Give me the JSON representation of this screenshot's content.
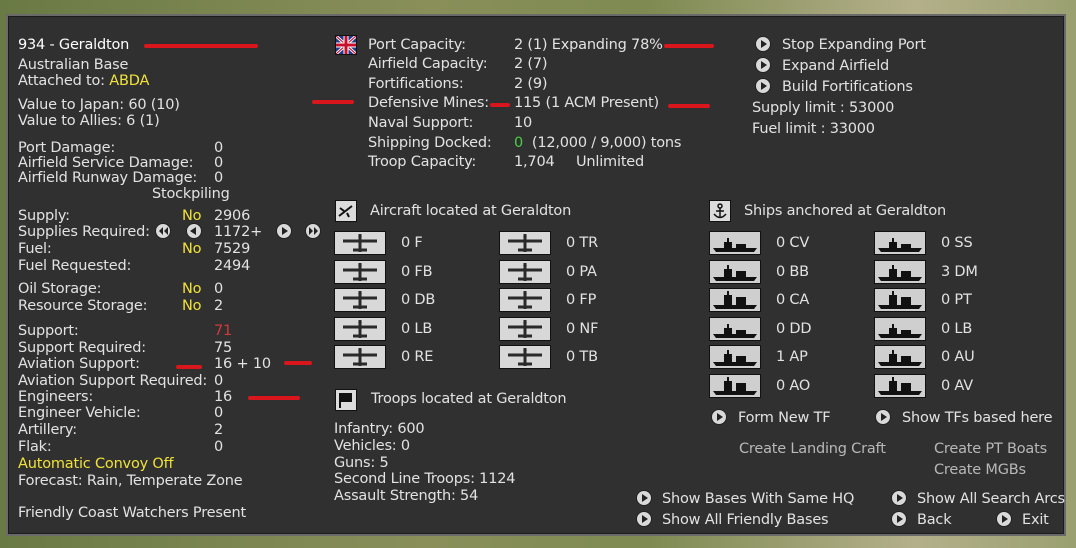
{
  "base": {
    "title": "934 - Geraldton",
    "nationality": "Australian Base",
    "attached_label": "Attached to:",
    "attached_value": "ABDA",
    "value_japan": "Value to Japan:  60 (10)",
    "value_allies": "Value to Allies:  6 (1)",
    "port_damage_label": "Port Damage:",
    "port_damage_value": "0",
    "airfield_service_label": "Airfield Service Damage:",
    "airfield_service_value": "0",
    "airfield_runway_label": "Airfield Runway Damage:",
    "airfield_runway_value": "0",
    "stockpiling_label": "Stockpiling",
    "supply_label": "Supply:",
    "supply_stock": "No",
    "supply_value": "2906",
    "supplies_required_label": "Supplies Required:",
    "supplies_required_value": "1172+",
    "fuel_label": "Fuel:",
    "fuel_stock": "No",
    "fuel_value": "7529",
    "fuel_requested_label": "Fuel Requested:",
    "fuel_requested_value": "2494",
    "oil_storage_label": "Oil Storage:",
    "oil_storage_stock": "No",
    "oil_storage_value": "0",
    "resource_storage_label": "Resource Storage:",
    "resource_storage_stock": "No",
    "resource_storage_value": "2",
    "support_label": "Support:",
    "support_value": "71",
    "support_required_label": "Support Required:",
    "support_required_value": "75",
    "aviation_support_label": "Aviation Support:",
    "aviation_support_value": "16 + 10",
    "aviation_support_required_label": "Aviation Support Required:",
    "aviation_support_required_value": "0",
    "engineers_label": "Engineers:",
    "engineers_value": "16",
    "engineer_vehicle_label": "Engineer Vehicle:",
    "engineer_vehicle_value": "0",
    "artillery_label": "Artillery:",
    "artillery_value": "2",
    "flak_label": "Flak:",
    "flak_value": "0",
    "convoy": "Automatic Convoy Off",
    "forecast": "Forecast: Rain, Temperate Zone",
    "coast_watchers": "Friendly Coast Watchers Present"
  },
  "port": {
    "port_capacity_label": "Port Capacity:",
    "port_capacity_value": "2 (1) Expanding 78%",
    "airfield_capacity_label": "Airfield Capacity:",
    "airfield_capacity_value": "2 (7)",
    "fortifications_label": "Fortifications:",
    "fortifications_value": "2 (9)",
    "defensive_mines_label": "Defensive Mines:",
    "defensive_mines_value": "115 (1 ACM Present)",
    "naval_support_label": "Naval Support:",
    "naval_support_value": "10",
    "shipping_docked_label": "Shipping Docked:",
    "shipping_docked_zero": "0",
    "shipping_docked_value": "(12,000 / 9,000) tons",
    "troop_capacity_label": "Troop Capacity:",
    "troop_capacity_value": "1,704",
    "troop_capacity_extra": "Unlimited"
  },
  "actions": {
    "stop_expanding_port": "Stop Expanding Port",
    "expand_airfield": "Expand Airfield",
    "build_fortifications": "Build Fortifications",
    "supply_limit": "Supply limit : 53000",
    "fuel_limit": "Fuel limit : 33000"
  },
  "aircraft": {
    "header": "Aircraft located at Geraldton",
    "left": [
      "0 F",
      "0 FB",
      "0 DB",
      "0 LB",
      "0 RE"
    ],
    "right": [
      "0 TR",
      "0 PA",
      "0 FP",
      "0 NF",
      "0 TB"
    ]
  },
  "ships": {
    "header": "Ships anchored at Geraldton",
    "left": [
      "0 CV",
      "0 BB",
      "0 CA",
      "0 DD",
      "1 AP",
      "0 AO"
    ],
    "right": [
      "0 SS",
      "3 DM",
      "0 PT",
      "0 LB",
      "0 AU",
      "0 AV"
    ],
    "form_new_tf": "Form New TF",
    "show_tfs": "Show TFs based here",
    "create_landing_craft": "Create Landing Craft",
    "create_pt_boats": "Create PT Boats",
    "create_mgbs": "Create MGBs"
  },
  "troops": {
    "header": "Troops located at Geraldton",
    "infantry": "Infantry: 600",
    "vehicles": "Vehicles: 0",
    "guns": "Guns: 5",
    "second_line": "Second Line Troops: 1124",
    "assault": "Assault Strength: 54"
  },
  "footer": {
    "show_bases_same_hq": "Show Bases With Same HQ",
    "show_all_friendly": "Show All Friendly Bases",
    "show_all_search_arcs": "Show All Search Arcs",
    "back": "Back",
    "exit": "Exit"
  }
}
